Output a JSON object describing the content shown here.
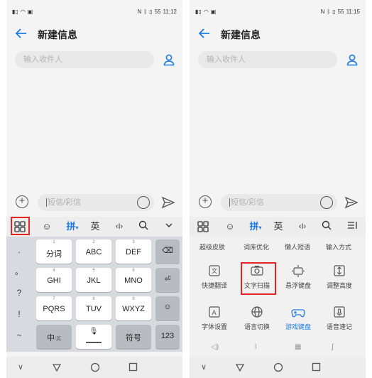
{
  "left": {
    "status_time": "11:12",
    "status_battery": "55",
    "title": "新建信息",
    "recipient_placeholder": "输入收件人",
    "message_placeholder": "短信/彩信",
    "toolbar": {
      "pinyin": "拼",
      "english": "英"
    },
    "keyboard": {
      "punct": [
        ".",
        "。",
        "?",
        "!",
        "~"
      ],
      "rows": [
        [
          {
            "sub": "1",
            "main": "分词"
          },
          {
            "sub": "2",
            "main": "ABC"
          },
          {
            "sub": "3",
            "main": "DEF"
          }
        ],
        [
          {
            "sub": "4",
            "main": "GHI"
          },
          {
            "sub": "5",
            "main": "JKL"
          },
          {
            "sub": "6",
            "main": "MNO"
          }
        ],
        [
          {
            "sub": "7",
            "main": "PQRS"
          },
          {
            "sub": "8",
            "main": "TUV"
          },
          {
            "sub": "9",
            "main": "WXYZ"
          }
        ]
      ],
      "zh_key": "中",
      "zh_key_sub": "/英",
      "symbol_key": "符号",
      "num_key": "123"
    }
  },
  "right": {
    "status_time": "11:15",
    "status_battery": "55",
    "title": "新建信息",
    "recipient_placeholder": "输入收件人",
    "message_placeholder": "短信/彩信",
    "toolbar": {
      "pinyin": "拼",
      "english": "英"
    },
    "panel": {
      "row1": [
        "超级皮肤",
        "词库优化",
        "懒人短语",
        "输入方式"
      ],
      "row2": [
        {
          "label": "快捷翻译",
          "icon": "translate-icon"
        },
        {
          "label": "文字扫描",
          "icon": "camera-icon"
        },
        {
          "label": "悬浮键盘",
          "icon": "floating-keyboard-icon"
        },
        {
          "label": "调整高度",
          "icon": "adjust-height-icon"
        }
      ],
      "row3": [
        {
          "label": "字体设置",
          "icon": "font-icon"
        },
        {
          "label": "语言切换",
          "icon": "globe-icon"
        },
        {
          "label": "游戏键盘",
          "icon": "gamepad-icon"
        },
        {
          "label": "语音速记",
          "icon": "voice-note-icon"
        }
      ]
    }
  },
  "colors": {
    "accent": "#1e7be4",
    "highlight": "#e52323"
  }
}
